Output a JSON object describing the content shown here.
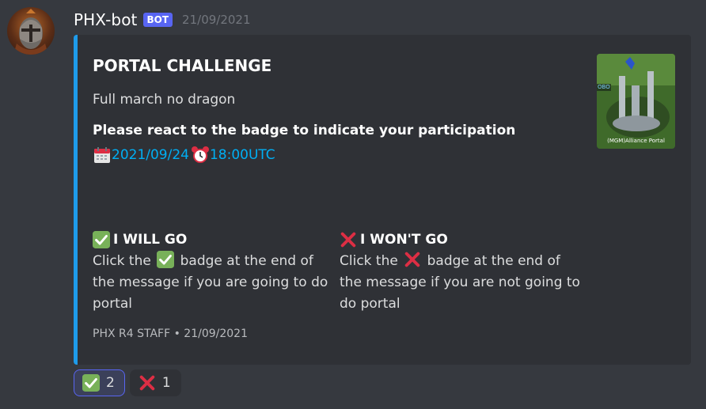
{
  "message": {
    "author": "PHX-bot",
    "bot_tag": "BOT",
    "timestamp": "21/09/2021",
    "avatar_icon": "knight-helmet-avatar"
  },
  "embed": {
    "accent_color": "#1e9bea",
    "title": "PORTAL CHALLENGE",
    "description": "Full march no dragon",
    "bold_line": "Please react to the badge to indicate your participation",
    "date": "2021/09/24",
    "time": "18:00UTC",
    "date_icon": "calendar-icon",
    "time_icon": "alarm-clock-icon",
    "thumbnail_caption": "(MGM)Alliance Portal",
    "thumbnail_label": "OBO",
    "fields": [
      {
        "icon": "check-mark-icon",
        "name": "I WILL GO",
        "value_prefix": "Click the",
        "value_suffix": "badge at the end of the message if you are going to do portal"
      },
      {
        "icon": "cross-mark-icon",
        "name": "I WON'T GO",
        "value_prefix": "Click the",
        "value_suffix": "badge at the end of the message if you are not going to do portal"
      }
    ],
    "footer": "PHX R4 STAFF • 21/09/2021"
  },
  "reactions": [
    {
      "icon": "check-mark-icon",
      "count": "2",
      "reacted": true
    },
    {
      "icon": "cross-mark-icon",
      "count": "1",
      "reacted": false
    }
  ]
}
